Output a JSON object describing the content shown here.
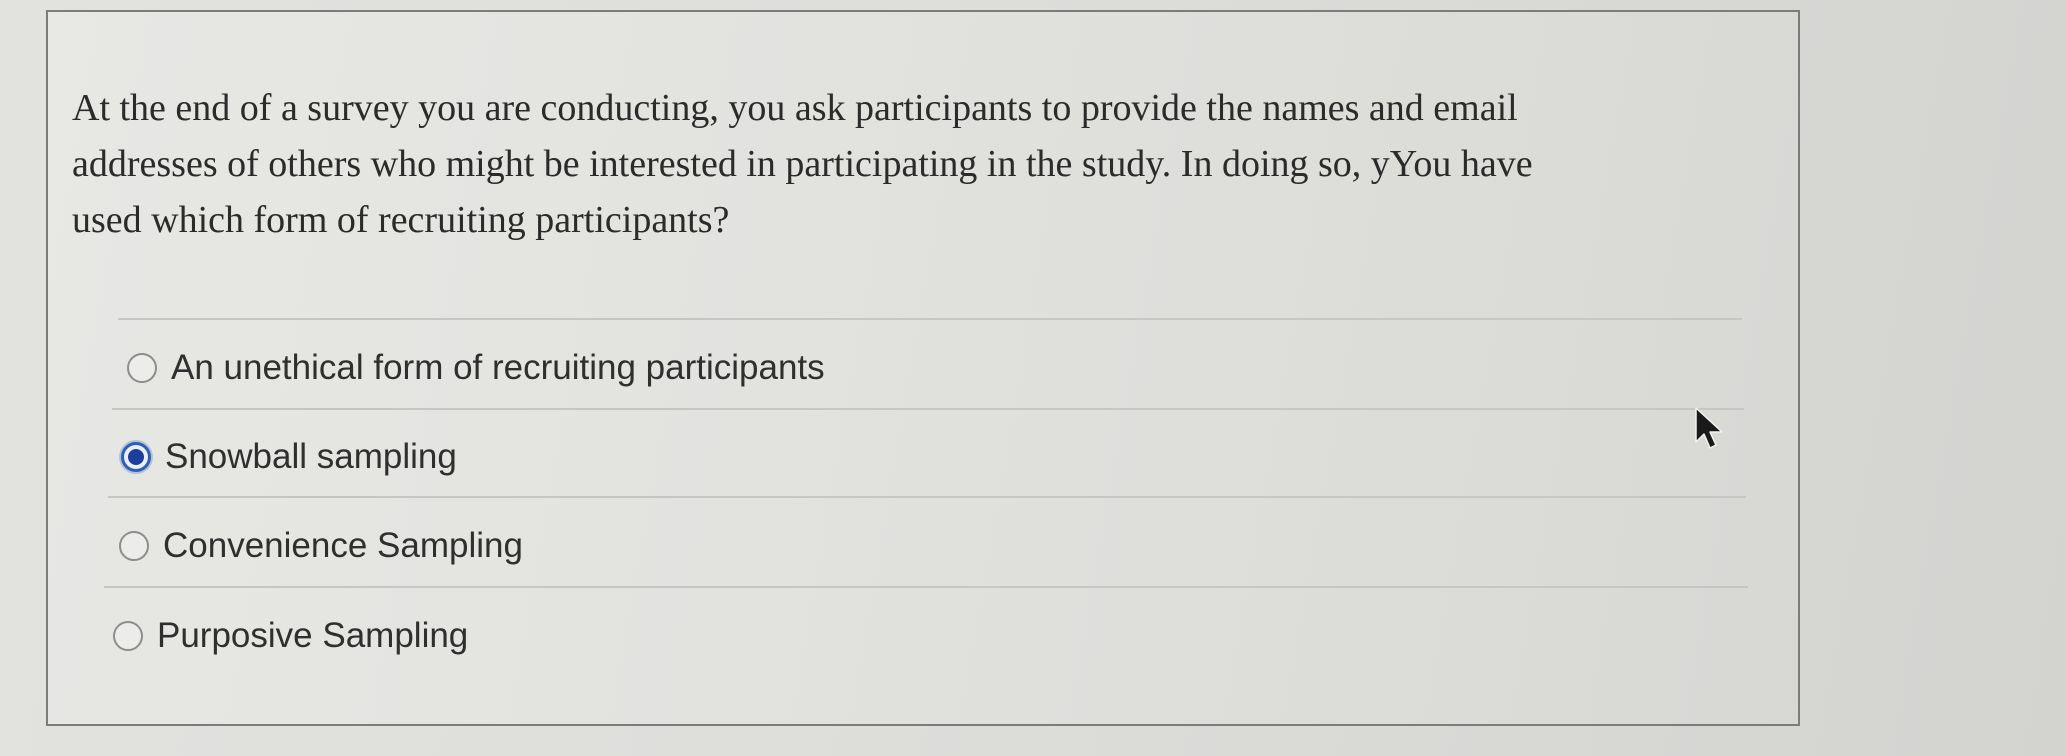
{
  "question": {
    "text": "At the end of a survey you are conducting, you ask participants to provide the names and email\naddresses of others who might be interested in participating in the study. In doing so, yYou have\nused which form of recruiting participants?"
  },
  "answers": [
    {
      "label": "An unethical form of recruiting participants",
      "selected": false
    },
    {
      "label": "Snowball sampling",
      "selected": true
    },
    {
      "label": "Convenience Sampling",
      "selected": false
    },
    {
      "label": "Purposive Sampling",
      "selected": false
    }
  ],
  "icons": {
    "cursor": "mouse-pointer-icon"
  },
  "colors": {
    "selected_radio": "#1d3f9c"
  }
}
